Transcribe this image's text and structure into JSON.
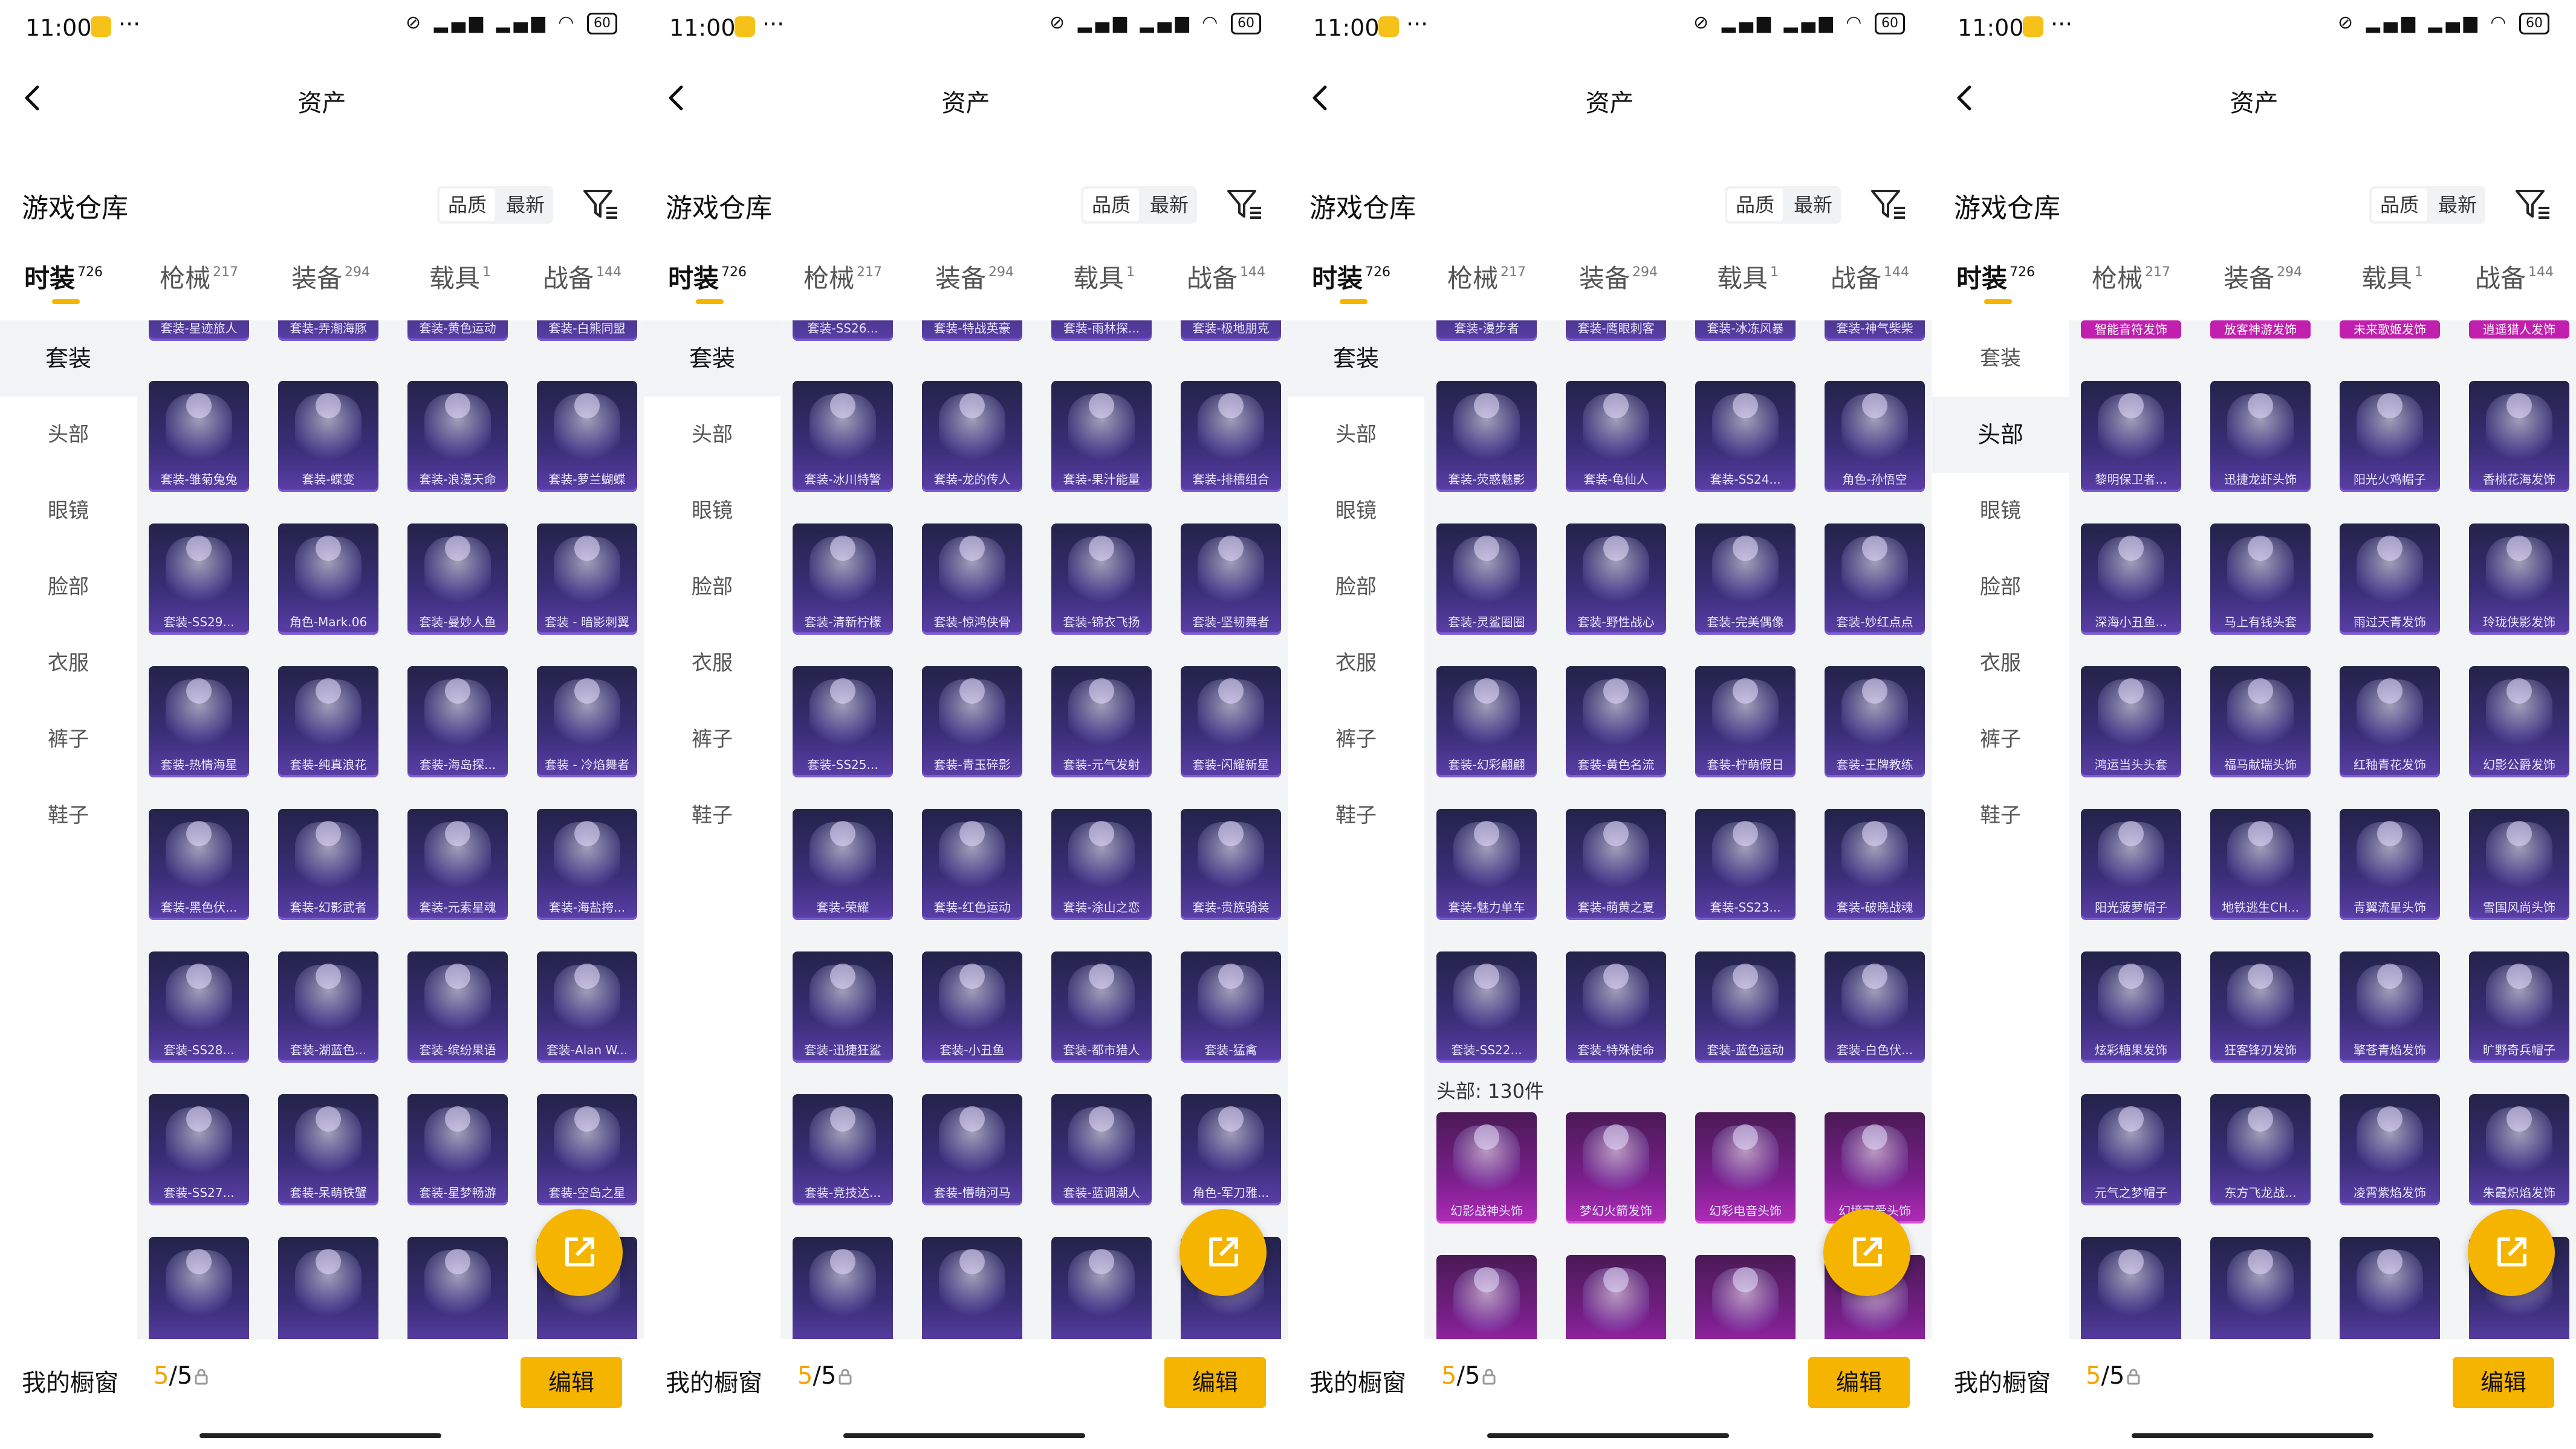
{
  "status": {
    "time": "11:00",
    "dots": "···",
    "battery": "60"
  },
  "nav": {
    "title": "资产"
  },
  "warehouse": {
    "title": "游戏仓库",
    "sort_quality": "品质",
    "sort_latest": "最新"
  },
  "tabs": [
    {
      "label": "时装",
      "count": "726"
    },
    {
      "label": "枪械",
      "count": "217"
    },
    {
      "label": "装备",
      "count": "294"
    },
    {
      "label": "载具",
      "count": "1"
    },
    {
      "label": "战备",
      "count": "144"
    }
  ],
  "side_items": [
    "套装",
    "头部",
    "眼镜",
    "脸部",
    "衣服",
    "裤子",
    "鞋子"
  ],
  "bottom": {
    "label": "我的橱窗",
    "count_current": "5",
    "count_sep": "/",
    "count_total": "5",
    "edit": "编辑"
  },
  "panels": [
    {
      "selected_side": 0,
      "top_row": [
        "套装-星迹旅人",
        "套装-弄潮海豚",
        "套装-黄色运动",
        "套装-白熊同盟"
      ],
      "rows": [
        [
          "套装-雏菊兔兔",
          "套装-蝶变",
          "套装-浪漫天命",
          "套装-萝兰蝴蝶"
        ],
        [
          "套装-SS29...",
          "角色-Mark.06",
          "套装-曼妙人鱼",
          "套装 - 暗影刺翼"
        ],
        [
          "套装-热情海星",
          "套装-纯真浪花",
          "套装-海岛探...",
          "套装 - 冷焰舞者"
        ],
        [
          "套装-黑色伏...",
          "套装-幻影武者",
          "套装-元素星魂",
          "套装-海盐挎..."
        ],
        [
          "套装-SS28...",
          "套装-湖蓝色...",
          "套装-缤纷果语",
          "套装-Alan W..."
        ],
        [
          "套装-SS27...",
          "套装-呆萌铁蟹",
          "套装-星梦畅游",
          "套装-空岛之星"
        ],
        [
          "",
          "",
          "",
          ""
        ]
      ]
    },
    {
      "selected_side": 0,
      "top_row": [
        "套装-SS26...",
        "套装-特战英豪",
        "套装-雨林探...",
        "套装-极地朋克"
      ],
      "rows": [
        [
          "套装-冰川特警",
          "套装-龙的传人",
          "套装-果汁能量",
          "套装-排槽组合"
        ],
        [
          "套装-清新柠檬",
          "套装-惊鸿侠骨",
          "套装-锦衣飞扬",
          "套装-坚韧舞者"
        ],
        [
          "套装-SS25...",
          "套装-青玉碎影",
          "套装-元气发射",
          "套装-闪耀新星"
        ],
        [
          "套装-荣耀",
          "套装-红色运动",
          "套装-涂山之恋",
          "套装-贵族骑装"
        ],
        [
          "套装-迅捷狂鲨",
          "套装-小丑鱼",
          "套装-都市猎人",
          "套装-猛禽"
        ],
        [
          "套装-竞技达...",
          "套装-懵萌河马",
          "套装-蓝调潮人",
          "角色-军刀雅..."
        ],
        [
          "",
          "",
          "",
          ""
        ]
      ]
    },
    {
      "selected_side": 0,
      "top_row": [
        "套装-漫步者",
        "套装-鹰眼刺客",
        "套装-冰冻风暴",
        "套装-神气柴柴"
      ],
      "rows": [
        [
          "套装-荧惑魅影",
          "套装-龟仙人",
          "套装-SS24...",
          "角色-孙悟空"
        ],
        [
          "套装-灵鲨圈圈",
          "套装-野性战心",
          "套装-完美偶像",
          "套装-妙红点点"
        ],
        [
          "套装-幻彩翩翩",
          "套装-黄色名流",
          "套装-柠萌假日",
          "套装-王牌教练"
        ],
        [
          "套装-魅力单车",
          "套装-萌黄之夏",
          "套装-SS23...",
          "套装-破晓战魂"
        ],
        [
          "套装-SS22...",
          "套装-特殊使命",
          "套装-蓝色运动",
          "套装-白色伏..."
        ]
      ],
      "section": "头部: 130件",
      "head_rows": [
        [
          "幻影战神头饰",
          "梦幻火箭发饰",
          "幻彩电音头饰",
          "幻境可爱头饰"
        ],
        [
          "",
          "",
          "",
          ""
        ]
      ]
    },
    {
      "selected_side": 1,
      "top_row": [
        "智能音符发饰",
        "放客神游发饰",
        "未来歌姬发饰",
        "逍遥猎人发饰"
      ],
      "rows": [
        [
          "黎明保卫者...",
          "迅捷龙虾头饰",
          "阳光火鸡帽子",
          "香桃花海发饰"
        ],
        [
          "深海小丑鱼...",
          "马上有钱头套",
          "雨过天青发饰",
          "玲珑侠影发饰"
        ],
        [
          "鸿运当头头套",
          "福马献瑞头饰",
          "红釉青花发饰",
          "幻影公爵发饰"
        ],
        [
          "阳光菠萝帽子",
          "地铁逃生CH...",
          "青翼流星头饰",
          "雪国风尚头饰"
        ],
        [
          "炫彩糖果发饰",
          "狂客锋刃发饰",
          "擎苍青焰发饰",
          "旷野奇兵帽子"
        ],
        [
          "元气之梦帽子",
          "东方飞龙战...",
          "凌霄紫焰发饰",
          "朱霞炽焰发饰"
        ],
        [
          "",
          "",
          "",
          ""
        ]
      ]
    }
  ]
}
